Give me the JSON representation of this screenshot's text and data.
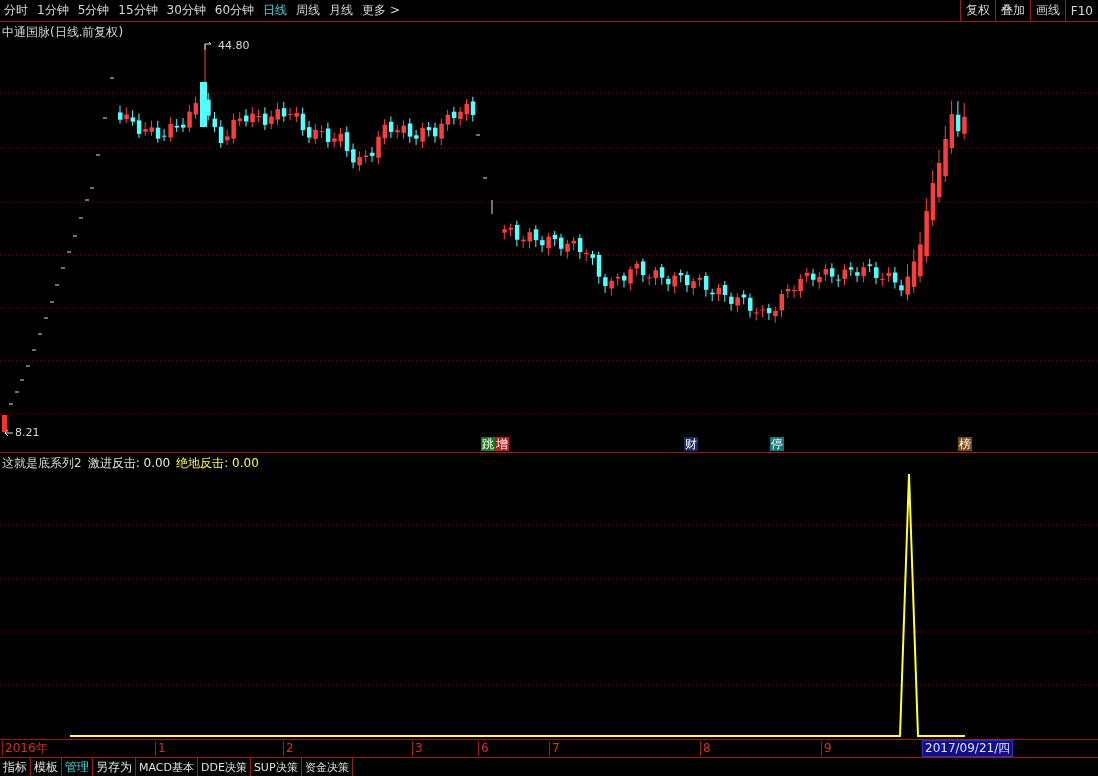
{
  "toolbar": {
    "periods": [
      {
        "label": "分时",
        "selected": false
      },
      {
        "label": "1分钟",
        "selected": false
      },
      {
        "label": "5分钟",
        "selected": false
      },
      {
        "label": "15分钟",
        "selected": false
      },
      {
        "label": "30分钟",
        "selected": false
      },
      {
        "label": "60分钟",
        "selected": false
      },
      {
        "label": "日线",
        "selected": true
      },
      {
        "label": "周线",
        "selected": false
      },
      {
        "label": "月线",
        "selected": false
      },
      {
        "label": "更多 >",
        "selected": false
      }
    ],
    "buttons": [
      "复权",
      "叠加",
      "画线",
      "F10"
    ]
  },
  "main_chart": {
    "title": "中通国脉(日线.前复权)",
    "high_label": "44.80",
    "low_label": "8.21",
    "event_tags": [
      {
        "text": "跳",
        "color": "#1c7a1c"
      },
      {
        "text": "增",
        "color": "#b81c1c"
      },
      {
        "text": "财",
        "color": "#1a2a66"
      },
      {
        "text": "停",
        "color": "#107878"
      },
      {
        "text": "榜",
        "color": "#7a4a14"
      }
    ]
  },
  "indicator": {
    "name": "这就是底系列2",
    "lines": [
      {
        "label": "激进反击: 0.00",
        "color": "#e6e6e6"
      },
      {
        "label": "绝地反击: 0.00",
        "color": "#ffff33"
      }
    ]
  },
  "time_axis": {
    "labels": [
      "2016年",
      "1",
      "2",
      "3",
      "6",
      "7",
      "8",
      "9"
    ],
    "cursor_date": "2017/09/21/四"
  },
  "bottom_tabs": [
    {
      "label": "指标",
      "selected": false
    },
    {
      "label": "模板",
      "selected": false
    },
    {
      "label": "管理",
      "selected": true
    },
    {
      "label": "另存为",
      "selected": false
    },
    {
      "label": "MACD基本",
      "selected": false
    },
    {
      "label": "DDE决策",
      "selected": false
    },
    {
      "label": "SUP决策",
      "selected": false
    },
    {
      "label": "资金决策",
      "selected": false
    }
  ]
}
